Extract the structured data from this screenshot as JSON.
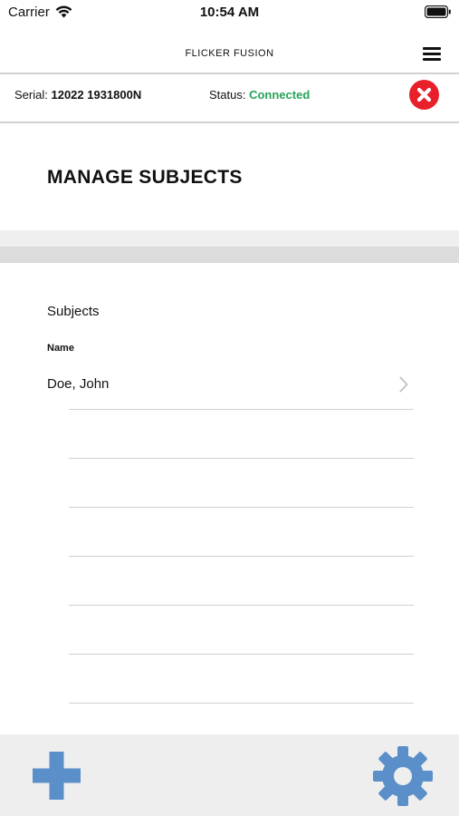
{
  "status_bar": {
    "carrier": "Carrier",
    "time": "10:54 AM",
    "wifi_icon": "wifi-icon",
    "battery_icon": "battery-icon"
  },
  "nav": {
    "title": "FLICKER FUSION",
    "menu_icon": "hamburger-menu-icon"
  },
  "device": {
    "serial_label": "Serial:",
    "serial_value": "12022 1931800N",
    "status_label": "Status:",
    "status_value": "Connected",
    "status_color": "#27a35a",
    "disconnect_icon": "close-circle-icon",
    "disconnect_color": "#e8202a"
  },
  "page": {
    "title": "MANAGE SUBJECTS"
  },
  "subjects": {
    "section_label": "Subjects",
    "column_header": "Name",
    "rows": [
      {
        "name": "Doe, John"
      },
      {
        "name": ""
      },
      {
        "name": ""
      },
      {
        "name": ""
      },
      {
        "name": ""
      },
      {
        "name": ""
      },
      {
        "name": ""
      }
    ]
  },
  "toolbar": {
    "add_icon": "plus-icon",
    "settings_icon": "gear-icon",
    "accent_color": "#5b8fc9"
  }
}
